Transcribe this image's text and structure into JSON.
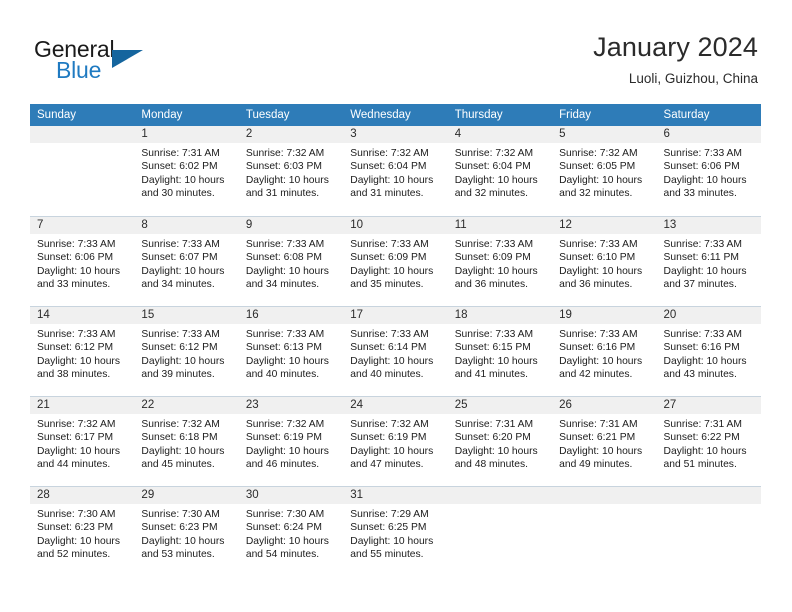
{
  "brand": {
    "name_top": "General",
    "name_bottom": "Blue",
    "triangle_color": "#15659e",
    "blue_color": "#1f7ac1"
  },
  "header": {
    "month_title": "January 2024",
    "location": "Luoli, Guizhou, China"
  },
  "theme": {
    "header_row_bg": "#2e7cb8",
    "day_band_bg": "#f0f0f0",
    "grid_line": "#c8d4de"
  },
  "labels": {
    "sunrise_prefix": "Sunrise:",
    "sunset_prefix": "Sunset:",
    "daylight_prefix": "Daylight:"
  },
  "day_names": [
    "Sunday",
    "Monday",
    "Tuesday",
    "Wednesday",
    "Thursday",
    "Friday",
    "Saturday"
  ],
  "weeks": [
    [
      {
        "empty": true
      },
      {
        "day": "1",
        "sunrise": "Sunrise: 7:31 AM",
        "sunset": "Sunset: 6:02 PM",
        "daylight_1": "Daylight: 10 hours",
        "daylight_2": "and 30 minutes."
      },
      {
        "day": "2",
        "sunrise": "Sunrise: 7:32 AM",
        "sunset": "Sunset: 6:03 PM",
        "daylight_1": "Daylight: 10 hours",
        "daylight_2": "and 31 minutes."
      },
      {
        "day": "3",
        "sunrise": "Sunrise: 7:32 AM",
        "sunset": "Sunset: 6:04 PM",
        "daylight_1": "Daylight: 10 hours",
        "daylight_2": "and 31 minutes."
      },
      {
        "day": "4",
        "sunrise": "Sunrise: 7:32 AM",
        "sunset": "Sunset: 6:04 PM",
        "daylight_1": "Daylight: 10 hours",
        "daylight_2": "and 32 minutes."
      },
      {
        "day": "5",
        "sunrise": "Sunrise: 7:32 AM",
        "sunset": "Sunset: 6:05 PM",
        "daylight_1": "Daylight: 10 hours",
        "daylight_2": "and 32 minutes."
      },
      {
        "day": "6",
        "sunrise": "Sunrise: 7:33 AM",
        "sunset": "Sunset: 6:06 PM",
        "daylight_1": "Daylight: 10 hours",
        "daylight_2": "and 33 minutes."
      }
    ],
    [
      {
        "day": "7",
        "sunrise": "Sunrise: 7:33 AM",
        "sunset": "Sunset: 6:06 PM",
        "daylight_1": "Daylight: 10 hours",
        "daylight_2": "and 33 minutes."
      },
      {
        "day": "8",
        "sunrise": "Sunrise: 7:33 AM",
        "sunset": "Sunset: 6:07 PM",
        "daylight_1": "Daylight: 10 hours",
        "daylight_2": "and 34 minutes."
      },
      {
        "day": "9",
        "sunrise": "Sunrise: 7:33 AM",
        "sunset": "Sunset: 6:08 PM",
        "daylight_1": "Daylight: 10 hours",
        "daylight_2": "and 34 minutes."
      },
      {
        "day": "10",
        "sunrise": "Sunrise: 7:33 AM",
        "sunset": "Sunset: 6:09 PM",
        "daylight_1": "Daylight: 10 hours",
        "daylight_2": "and 35 minutes."
      },
      {
        "day": "11",
        "sunrise": "Sunrise: 7:33 AM",
        "sunset": "Sunset: 6:09 PM",
        "daylight_1": "Daylight: 10 hours",
        "daylight_2": "and 36 minutes."
      },
      {
        "day": "12",
        "sunrise": "Sunrise: 7:33 AM",
        "sunset": "Sunset: 6:10 PM",
        "daylight_1": "Daylight: 10 hours",
        "daylight_2": "and 36 minutes."
      },
      {
        "day": "13",
        "sunrise": "Sunrise: 7:33 AM",
        "sunset": "Sunset: 6:11 PM",
        "daylight_1": "Daylight: 10 hours",
        "daylight_2": "and 37 minutes."
      }
    ],
    [
      {
        "day": "14",
        "sunrise": "Sunrise: 7:33 AM",
        "sunset": "Sunset: 6:12 PM",
        "daylight_1": "Daylight: 10 hours",
        "daylight_2": "and 38 minutes."
      },
      {
        "day": "15",
        "sunrise": "Sunrise: 7:33 AM",
        "sunset": "Sunset: 6:12 PM",
        "daylight_1": "Daylight: 10 hours",
        "daylight_2": "and 39 minutes."
      },
      {
        "day": "16",
        "sunrise": "Sunrise: 7:33 AM",
        "sunset": "Sunset: 6:13 PM",
        "daylight_1": "Daylight: 10 hours",
        "daylight_2": "and 40 minutes."
      },
      {
        "day": "17",
        "sunrise": "Sunrise: 7:33 AM",
        "sunset": "Sunset: 6:14 PM",
        "daylight_1": "Daylight: 10 hours",
        "daylight_2": "and 40 minutes."
      },
      {
        "day": "18",
        "sunrise": "Sunrise: 7:33 AM",
        "sunset": "Sunset: 6:15 PM",
        "daylight_1": "Daylight: 10 hours",
        "daylight_2": "and 41 minutes."
      },
      {
        "day": "19",
        "sunrise": "Sunrise: 7:33 AM",
        "sunset": "Sunset: 6:16 PM",
        "daylight_1": "Daylight: 10 hours",
        "daylight_2": "and 42 minutes."
      },
      {
        "day": "20",
        "sunrise": "Sunrise: 7:33 AM",
        "sunset": "Sunset: 6:16 PM",
        "daylight_1": "Daylight: 10 hours",
        "daylight_2": "and 43 minutes."
      }
    ],
    [
      {
        "day": "21",
        "sunrise": "Sunrise: 7:32 AM",
        "sunset": "Sunset: 6:17 PM",
        "daylight_1": "Daylight: 10 hours",
        "daylight_2": "and 44 minutes."
      },
      {
        "day": "22",
        "sunrise": "Sunrise: 7:32 AM",
        "sunset": "Sunset: 6:18 PM",
        "daylight_1": "Daylight: 10 hours",
        "daylight_2": "and 45 minutes."
      },
      {
        "day": "23",
        "sunrise": "Sunrise: 7:32 AM",
        "sunset": "Sunset: 6:19 PM",
        "daylight_1": "Daylight: 10 hours",
        "daylight_2": "and 46 minutes."
      },
      {
        "day": "24",
        "sunrise": "Sunrise: 7:32 AM",
        "sunset": "Sunset: 6:19 PM",
        "daylight_1": "Daylight: 10 hours",
        "daylight_2": "and 47 minutes."
      },
      {
        "day": "25",
        "sunrise": "Sunrise: 7:31 AM",
        "sunset": "Sunset: 6:20 PM",
        "daylight_1": "Daylight: 10 hours",
        "daylight_2": "and 48 minutes."
      },
      {
        "day": "26",
        "sunrise": "Sunrise: 7:31 AM",
        "sunset": "Sunset: 6:21 PM",
        "daylight_1": "Daylight: 10 hours",
        "daylight_2": "and 49 minutes."
      },
      {
        "day": "27",
        "sunrise": "Sunrise: 7:31 AM",
        "sunset": "Sunset: 6:22 PM",
        "daylight_1": "Daylight: 10 hours",
        "daylight_2": "and 51 minutes."
      }
    ],
    [
      {
        "day": "28",
        "sunrise": "Sunrise: 7:30 AM",
        "sunset": "Sunset: 6:23 PM",
        "daylight_1": "Daylight: 10 hours",
        "daylight_2": "and 52 minutes."
      },
      {
        "day": "29",
        "sunrise": "Sunrise: 7:30 AM",
        "sunset": "Sunset: 6:23 PM",
        "daylight_1": "Daylight: 10 hours",
        "daylight_2": "and 53 minutes."
      },
      {
        "day": "30",
        "sunrise": "Sunrise: 7:30 AM",
        "sunset": "Sunset: 6:24 PM",
        "daylight_1": "Daylight: 10 hours",
        "daylight_2": "and 54 minutes."
      },
      {
        "day": "31",
        "sunrise": "Sunrise: 7:29 AM",
        "sunset": "Sunset: 6:25 PM",
        "daylight_1": "Daylight: 10 hours",
        "daylight_2": "and 55 minutes."
      },
      {
        "empty": true
      },
      {
        "empty": true
      },
      {
        "empty": true
      }
    ]
  ]
}
